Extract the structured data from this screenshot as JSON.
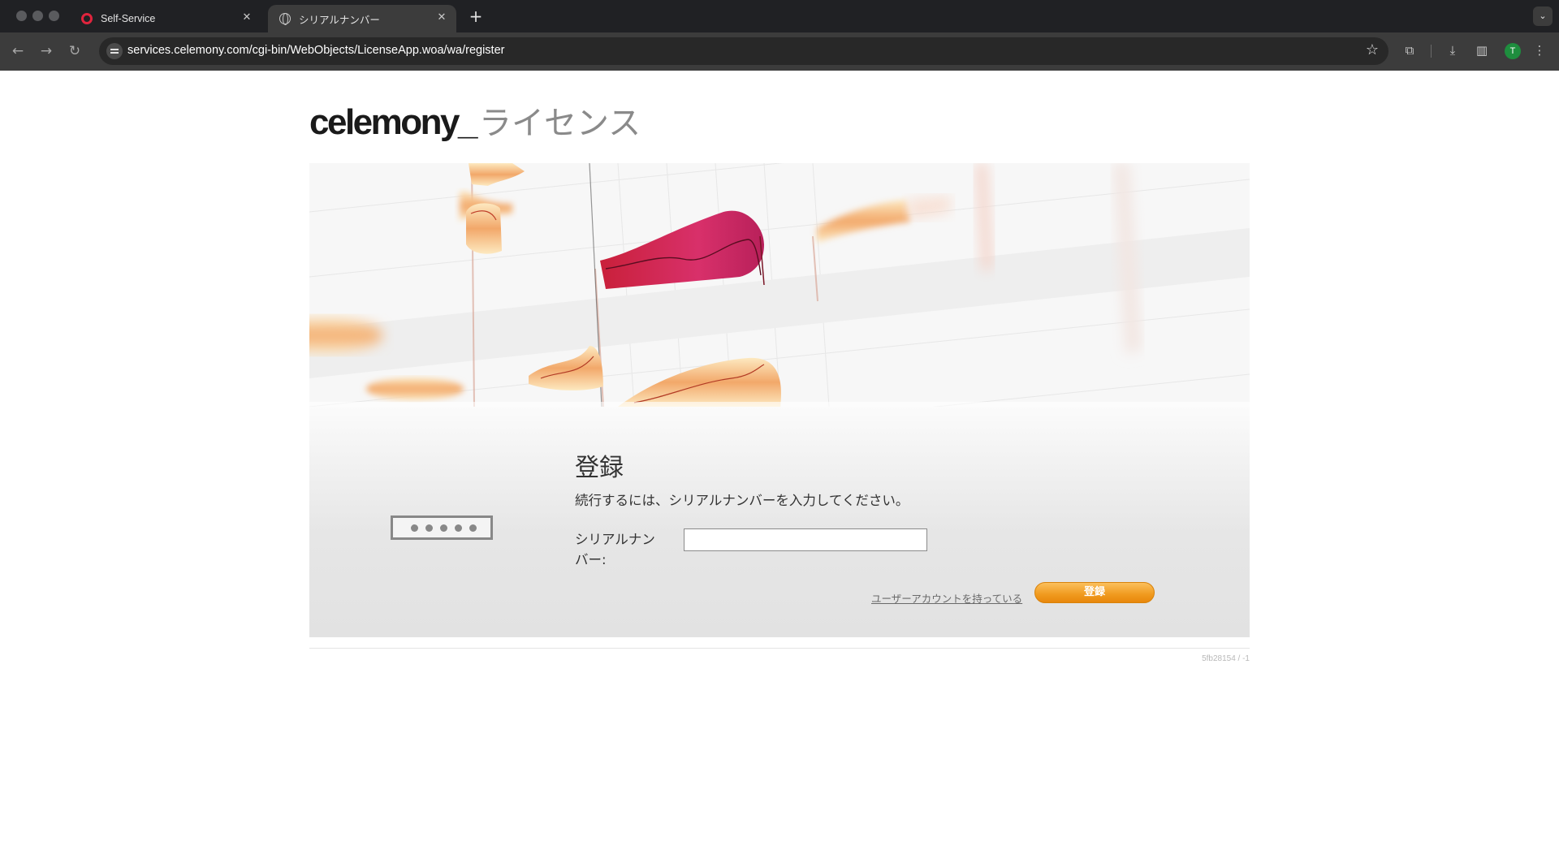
{
  "browser": {
    "tabs": [
      {
        "title": "Self-Service",
        "favicon": "opera-icon",
        "active": false
      },
      {
        "title": "シリアルナンバー",
        "favicon": "globe-icon",
        "active": true
      }
    ],
    "url": "services.celemony.com/cgi-bin/WebObjects/LicenseApp.woa/wa/register",
    "profile_initial": "T"
  },
  "header": {
    "logo": "celemony_",
    "subtitle": "ライセンス"
  },
  "banner": {
    "description_icon": "melodyne-blobs-illustration"
  },
  "register": {
    "title": "登録",
    "description": "続行するには、シリアルナンバーを入力してください。",
    "serial_label": "シリアルナンバー:",
    "serial_value": "",
    "account_link": "ユーザーアカウントを持っている",
    "submit_label": "登録"
  },
  "footer": {
    "build_id": "5fb28154 / -1"
  },
  "colors": {
    "accent": "#f09a1e",
    "text": "#333333",
    "chrome": "#202124"
  }
}
